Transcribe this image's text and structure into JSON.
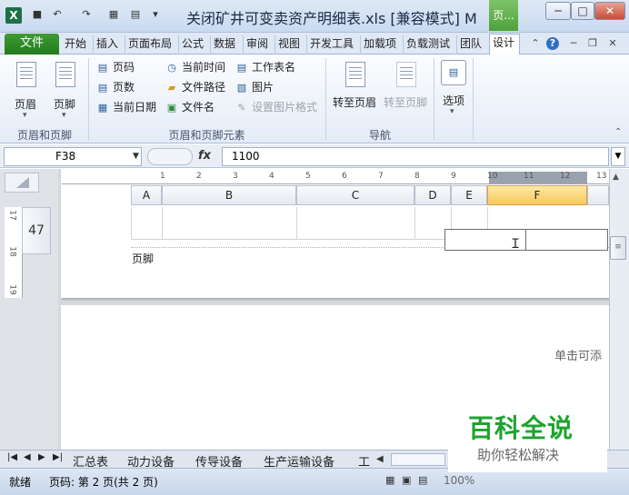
{
  "titlebar": {
    "title": "关闭矿井可变卖资产明细表.xls  [兼容模式] M",
    "context_tab": "页...",
    "app_icon": "X",
    "quick_access_icons": [
      "save-icon",
      "undo-icon",
      "redo-icon",
      "customize-icon"
    ],
    "window_buttons": [
      "minimize-icon",
      "maximize-icon",
      "close-icon"
    ]
  },
  "tabs": {
    "file": "文件",
    "items": [
      "开始",
      "插入",
      "页面布局",
      "公式",
      "数据",
      "审阅",
      "视图",
      "开发工具",
      "加载项",
      "负载测试",
      "团队",
      "设计"
    ],
    "active": "设计"
  },
  "ribbon": {
    "group1": {
      "header": "页眉",
      "footer": "页脚",
      "label": "页眉和页脚"
    },
    "group2": {
      "col1": [
        "页码",
        "页数",
        "当前日期"
      ],
      "col2": [
        "当前时间",
        "文件路径",
        "文件名"
      ],
      "col3": [
        "工作表名",
        "图片",
        "设置图片格式"
      ],
      "label": "页眉和页脚元素"
    },
    "group3": {
      "goto_header": "转至页眉",
      "goto_footer": "转至页脚",
      "label": "导航"
    },
    "group4": {
      "options": "选项"
    }
  },
  "formula_bar": {
    "name_box": "F38",
    "fx": "fx",
    "formula": "1100"
  },
  "sheet": {
    "row_number": "47",
    "columns": [
      "A",
      "B",
      "C",
      "D",
      "E",
      "F"
    ],
    "selected_column": "F",
    "footer_label": "页脚",
    "click_to_add": "单击可添",
    "ruler_h": [
      "1",
      "2",
      "3",
      "4",
      "5",
      "6",
      "7",
      "8",
      "9",
      "10",
      "11",
      "12",
      "13"
    ],
    "ruler_v": [
      "17",
      "18",
      "19"
    ]
  },
  "sheet_tabs": [
    "汇总表",
    "动力设备",
    "传导设备",
    "生产运输设备",
    "工"
  ],
  "status": {
    "ready": "就绪",
    "page": "页码: 第 2 页(共 2 页)",
    "zoom": "100%"
  },
  "watermark": {
    "main": "百科全说",
    "sub": "助你轻松解决"
  }
}
